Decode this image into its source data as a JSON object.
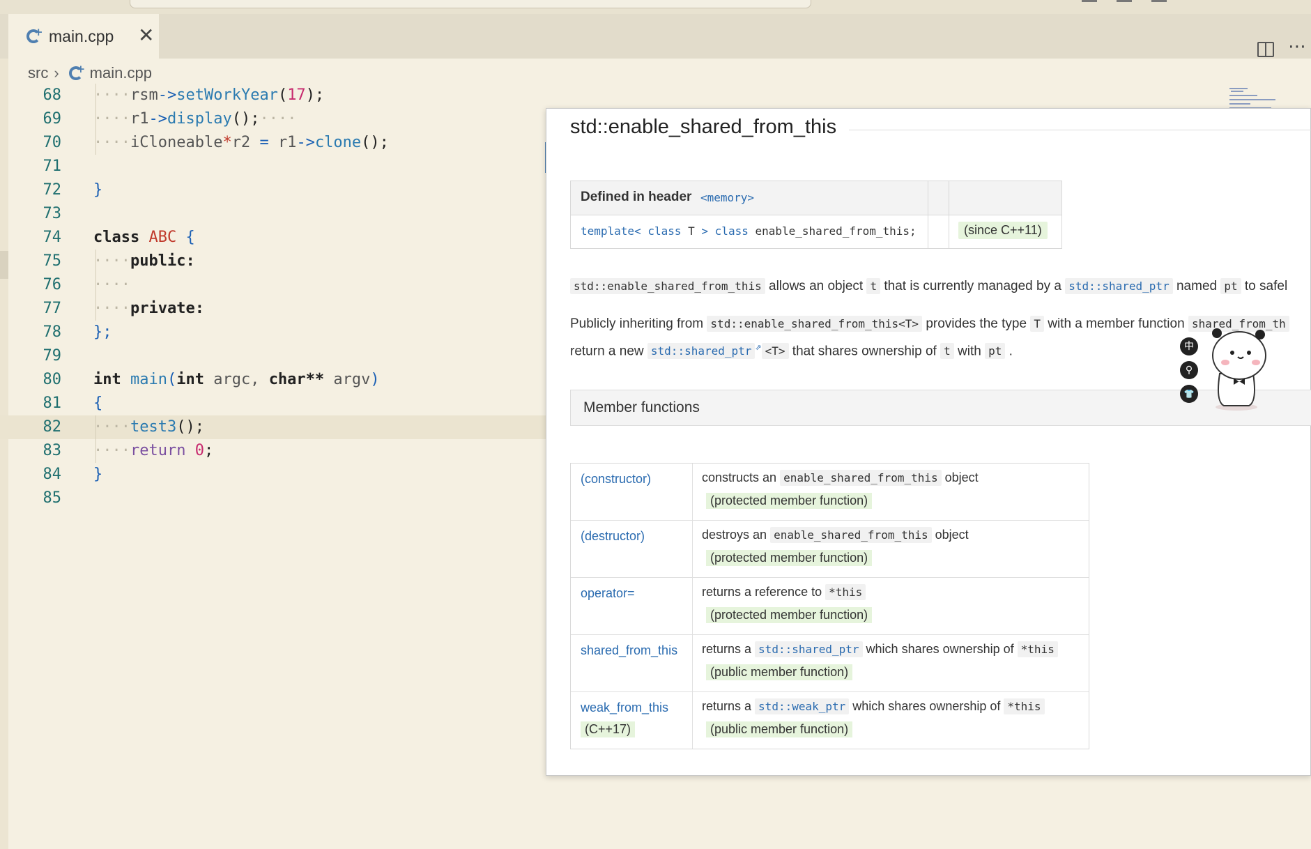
{
  "tab": {
    "label": "main.cpp",
    "close": "✕"
  },
  "breadcrumb": {
    "folder": "src",
    "file": "main.cpp"
  },
  "editor": {
    "lines": [
      {
        "n": "68",
        "code": [
          [
            "ind",
            "····"
          ],
          [
            "v",
            "rsm"
          ],
          [
            "p",
            "->"
          ],
          [
            "f",
            "setWorkYear"
          ],
          [
            "c",
            "("
          ],
          [
            "n",
            "17"
          ],
          [
            "c",
            ");"
          ]
        ]
      },
      {
        "n": "69",
        "code": [
          [
            "ind",
            "····"
          ],
          [
            "v",
            "r1"
          ],
          [
            "p",
            "->"
          ],
          [
            "f",
            "display"
          ],
          [
            "c",
            "();"
          ],
          [
            "ind",
            "····"
          ]
        ]
      },
      {
        "n": "70",
        "code": [
          [
            "ind",
            "····"
          ],
          [
            "v",
            "iCloneable"
          ],
          [
            "t",
            "*"
          ],
          [
            "v",
            "r2 "
          ],
          [
            "p",
            "= "
          ],
          [
            "v",
            "r1"
          ],
          [
            "p",
            "->"
          ],
          [
            "f",
            "clone"
          ],
          [
            "c",
            "();"
          ]
        ]
      },
      {
        "n": "71",
        "code": []
      },
      {
        "n": "72",
        "code": [
          [
            "p",
            "}"
          ]
        ]
      },
      {
        "n": "73",
        "code": []
      },
      {
        "n": "74",
        "code": [
          [
            "k",
            "class "
          ],
          [
            "t",
            "ABC "
          ],
          [
            "p",
            "{"
          ]
        ]
      },
      {
        "n": "75",
        "code": [
          [
            "ind",
            "····"
          ],
          [
            "k",
            "public:"
          ]
        ]
      },
      {
        "n": "76",
        "code": [
          [
            "ind",
            "····"
          ]
        ]
      },
      {
        "n": "77",
        "code": [
          [
            "ind",
            "····"
          ],
          [
            "k",
            "private:"
          ]
        ]
      },
      {
        "n": "78",
        "code": [
          [
            "p",
            "};"
          ]
        ]
      },
      {
        "n": "79",
        "code": []
      },
      {
        "n": "80",
        "code": [
          [
            "k",
            "int "
          ],
          [
            "f",
            "main"
          ],
          [
            "p",
            "("
          ],
          [
            "k",
            "int "
          ],
          [
            "v",
            "argc, "
          ],
          [
            "k",
            "char** "
          ],
          [
            "v",
            "argv"
          ],
          [
            "p",
            ")"
          ]
        ]
      },
      {
        "n": "81",
        "code": [
          [
            "p",
            "{"
          ]
        ]
      },
      {
        "n": "82",
        "code": [
          [
            "ind",
            "····"
          ],
          [
            "f",
            "test3"
          ],
          [
            "c",
            "();"
          ]
        ]
      },
      {
        "n": "83",
        "code": [
          [
            "ind",
            "····"
          ],
          [
            "r",
            "return "
          ],
          [
            "n",
            "0"
          ],
          [
            "c",
            ";"
          ]
        ]
      },
      {
        "n": "84",
        "code": [
          [
            "p",
            "}"
          ]
        ]
      },
      {
        "n": "85",
        "code": []
      }
    ]
  },
  "hover": {
    "title": "std::enable_shared_from_this",
    "header_label": "Defined in header",
    "header_file": "<memory>",
    "template_kw1": "template",
    "template_lt": "< ",
    "template_kw2": "class",
    "template_T": " T ",
    "template_gt": "> ",
    "template_kw3": "class",
    "template_rest": " enable_shared_from_this;",
    "since": "(since C++11)",
    "p1": {
      "code1": "std::enable_shared_from_this",
      "t1": " allows an object ",
      "code2": "t",
      "t2": " that is currently managed by a ",
      "link1": "std::shared_ptr",
      "t3": " named ",
      "code3": "pt",
      "t4": " to safel"
    },
    "p2": {
      "t1": "Publicly inheriting from ",
      "code1": "std::enable_shared_from_this<T>",
      "t2": " provides the type ",
      "code2": "T",
      "t3": " with a member function ",
      "code3": "shared_from_th"
    },
    "p3": {
      "t1": "return a new ",
      "link1": "std::shared_ptr",
      "code1": "<T>",
      "t2": " that shares ownership of ",
      "code2": "t",
      "t3": " with ",
      "code3": "pt",
      "t4": " ."
    },
    "member_functions_label": "Member functions",
    "members": [
      {
        "name": "(constructor)",
        "sub": "",
        "d1": "constructs an ",
        "dcode": "enable_shared_from_this",
        "dlink": "",
        "d2": " object",
        "dcode2": "",
        "kind": "(protected member function)"
      },
      {
        "name": "(destructor)",
        "sub": "",
        "d1": "destroys an ",
        "dcode": "enable_shared_from_this",
        "dlink": "",
        "d2": " object",
        "dcode2": "",
        "kind": "(protected member function)"
      },
      {
        "name": "operator=",
        "sub": "",
        "d1": "returns a reference to ",
        "dcode": "*this",
        "dlink": "",
        "d2": "",
        "dcode2": "",
        "kind": "(protected member function)"
      },
      {
        "name": "shared_from_this",
        "sub": "",
        "d1": "returns a ",
        "dcode": "",
        "dlink": "std::shared_ptr",
        "d2": " which shares ownership of ",
        "dcode2": "*this",
        "kind": "(public member function)"
      },
      {
        "name": "weak_from_this",
        "sub": "(C++17)",
        "d1": "returns a ",
        "dcode": "",
        "dlink": "std::weak_ptr",
        "d2": " which shares ownership of ",
        "dcode2": "*this",
        "kind": "(public member function)"
      }
    ]
  },
  "widget": {
    "icon1": "中",
    "icon2": "⚲",
    "icon3": "👕"
  }
}
